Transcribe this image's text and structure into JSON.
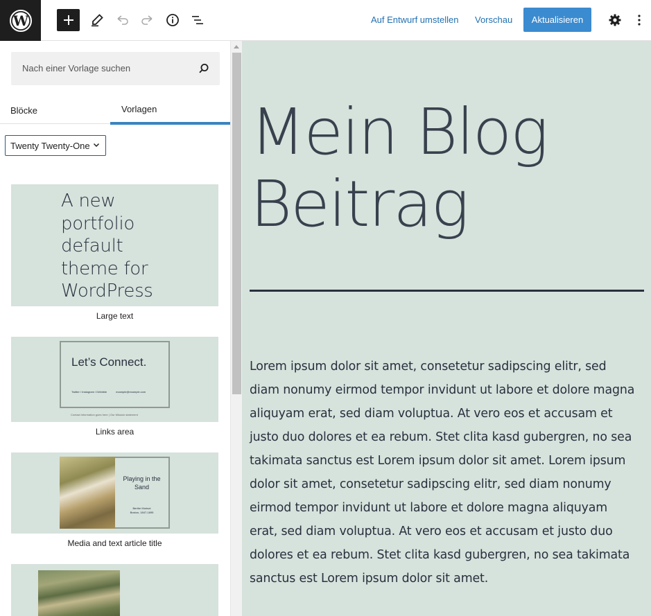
{
  "toolbar": {
    "logo_icon": "wordpress-logo-icon",
    "add_icon": "plus-icon",
    "tools_icon": "pencil-icon",
    "undo_icon": "undo-icon",
    "redo_icon": "redo-icon",
    "details_icon": "info-icon",
    "list_view_icon": "list-view-icon",
    "switch_to_draft": "Auf Entwurf umstellen",
    "preview": "Vorschau",
    "update": "Aktualisieren",
    "settings_icon": "gear-icon",
    "options_icon": "kebab-menu-icon",
    "accent_color": "#3b8bd0"
  },
  "sidebar": {
    "search": {
      "placeholder": "Nach einer Vorlage suchen",
      "icon": "search-icon"
    },
    "tabs": [
      {
        "label": "Blöcke",
        "active": false
      },
      {
        "label": "Vorlagen",
        "active": true
      }
    ],
    "pattern_source": {
      "selected": "Twenty Twenty-One",
      "icon": "chevron-down-icon"
    },
    "patterns": [
      {
        "label": "Large text",
        "preview_lines": [
          "A new",
          "portfolio",
          "default",
          "theme for",
          "WordPress"
        ]
      },
      {
        "label": "Links area",
        "preview_title": "Let’s Connect.",
        "preview_links": "Twitter  /  Instagram  /  Dribbble",
        "preview_email": "example@example.com",
        "preview_footer": "Contact information goes here   |   Our Mission statement"
      },
      {
        "label": "Media and text article title",
        "preview_title": "Playing in the Sand",
        "preview_subtitle": "Berthe Morisot\nBoston, 1847-1895"
      },
      {
        "label": ""
      }
    ]
  },
  "canvas": {
    "background_color": "#d6e2dc",
    "title": "Mein Blog Beitrag",
    "body": "Lorem ipsum dolor sit amet, consetetur sadipscing elitr, sed diam nonumy eirmod tempor invidunt ut labore et dolore magna aliquyam erat, sed diam voluptua. At vero eos et accusam et justo duo dolores et ea rebum. Stet clita kasd gubergren, no sea takimata sanctus est Lorem ipsum dolor sit amet. Lorem ipsum dolor sit amet, consetetur sadipscing elitr, sed diam nonumy eirmod tempor invidunt ut labore et dolore magna aliquyam erat, sed diam voluptua. At vero eos et accusam et justo duo dolores et ea rebum. Stet clita kasd gubergren, no sea takimata sanctus est Lorem ipsum dolor sit amet."
  }
}
